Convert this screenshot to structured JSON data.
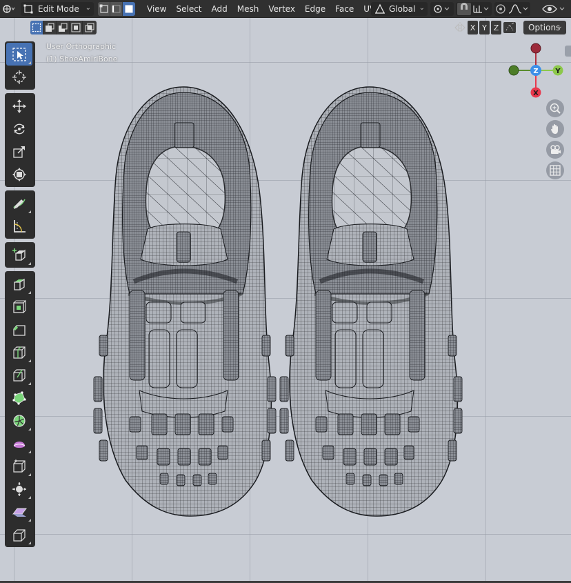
{
  "header": {
    "mode": "Edit Mode",
    "menus": [
      "View",
      "Select",
      "Add",
      "Mesh",
      "Vertex",
      "Edge",
      "Face",
      "UV"
    ],
    "orientation": "Global"
  },
  "tool_header": {
    "mirror_axes": [
      "X",
      "Y",
      "Z"
    ],
    "options_label": "Options"
  },
  "viewport": {
    "view_name": "User Orthographic",
    "object_name": "(1) ShoeAmiriBone"
  },
  "gizmo": {
    "x_label": "X",
    "y_label": "Y",
    "z_label": "Z",
    "x_color": "#e8394d",
    "y_color": "#8cc84a",
    "z_color": "#3c8fe8"
  },
  "toolbar": {
    "tools": [
      "select-box",
      "cursor",
      "move",
      "rotate",
      "scale",
      "transform",
      "annotate",
      "measure",
      "add-cube",
      "extrude-region",
      "inset-faces",
      "bevel",
      "loop-cut",
      "knife",
      "poly-build",
      "spin",
      "smooth",
      "edge-slide",
      "shrink-fatten",
      "shear",
      "rip-region"
    ]
  },
  "colors": {
    "accent": "#4772b3",
    "viewport_bg": "#c8ccd4",
    "header_bg": "#303030"
  }
}
